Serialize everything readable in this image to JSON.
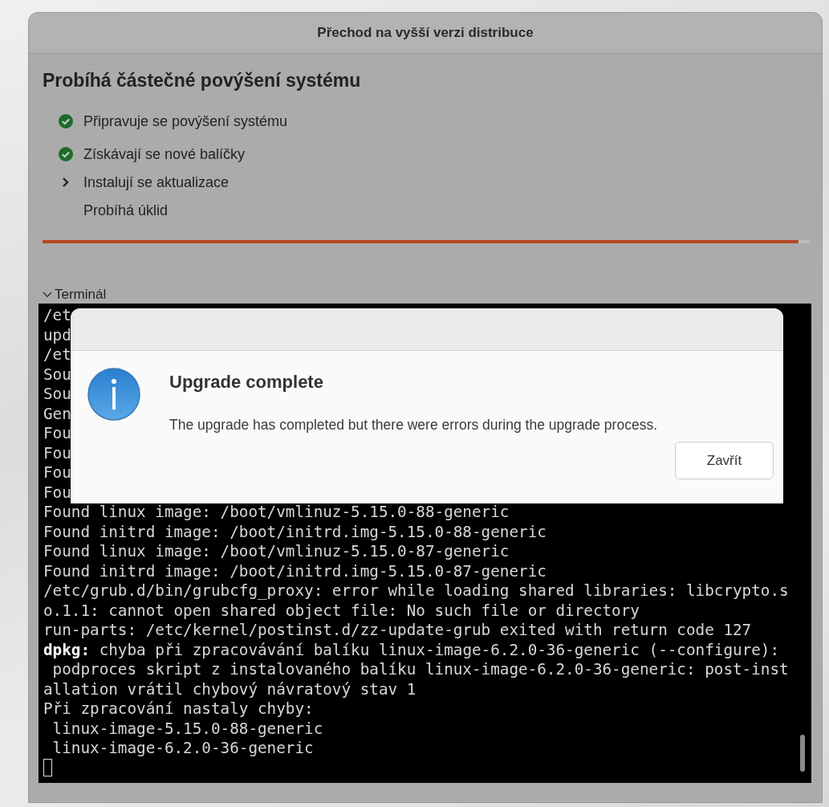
{
  "window": {
    "title": "Přechod na vyšší verzi distribuce"
  },
  "heading": "Probíhá částečné povýšení systému",
  "steps": [
    {
      "label": "Připravuje se povýšení systému",
      "kind": "done"
    },
    {
      "label": "Získávají se nové balíčky",
      "kind": "done"
    },
    {
      "label": "Instalují se aktualizace",
      "kind": "current"
    },
    {
      "label": "Probíhá úklid",
      "kind": "pending"
    }
  ],
  "progress": {
    "level": 0.985
  },
  "terminal": {
    "label": "Terminál",
    "expanded": true,
    "lines": [
      "/et",
      "upd",
      "/et",
      "Sou",
      "Sou",
      "Gen",
      "Fou",
      "Fou",
      "Fou",
      "Fou",
      "Found linux image: /boot/vmlinuz-5.15.0-88-generic",
      "Found initrd image: /boot/initrd.img-5.15.0-88-generic",
      "Found linux image: /boot/vmlinuz-5.15.0-87-generic",
      "Found initrd image: /boot/initrd.img-5.15.0-87-generic",
      "/etc/grub.d/bin/grubcfg_proxy: error while loading shared libraries: libcrypto.s",
      "o.1.1: cannot open shared object file: No such file or directory",
      "run-parts: /etc/kernel/postinst.d/zz-update-grub exited with return code 127",
      "**dpkg:** chyba při zpracovávání balíku linux-image-6.2.0-36-generic (--configure):",
      " podproces skript z instalovaného balíku linux-image-6.2.0-36-generic: post-inst",
      "allation vrátil chybový návratový stav 1",
      "Při zpracování nastaly chyby:",
      " linux-image-5.15.0-88-generic",
      " linux-image-6.2.0-36-generic"
    ]
  },
  "dialog": {
    "title": "Upgrade complete",
    "message": "The upgrade has completed but there were errors during the upgrade process.",
    "buttons": [
      "Zavřít"
    ]
  }
}
